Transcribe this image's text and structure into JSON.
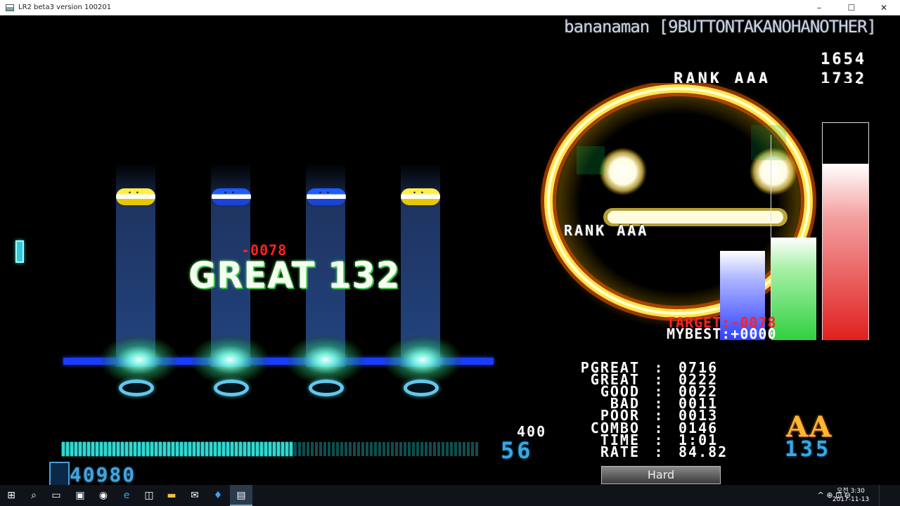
{
  "window": {
    "title": "LR2 beta3 version 100201",
    "minimize": "–",
    "maximize": "☐",
    "close": "✕"
  },
  "game": {
    "song_title": "bananaman [9BUTTONTAKANOHANOTHER]",
    "top_score_1": "1654",
    "top_rank": "RANK AAA",
    "top_score_2": "1732",
    "fast_slow": "-0078",
    "judge": "GREAT 132",
    "rank_mid": "RANK AAA",
    "target": "TARGET:-0078",
    "mybest": "MYBEST:+0000",
    "num_400": "400",
    "bpm_left": "56",
    "bpm_right": "135",
    "ex_score_lead": "0",
    "ex_score": "40980",
    "grade": "AA",
    "gauge_type": "Hard",
    "gauge_fill": 0.56,
    "stats": [
      {
        "label": "PGREAT",
        "value": "0716"
      },
      {
        "label": "GREAT",
        "value": "0222"
      },
      {
        "label": "GOOD",
        "value": "0022"
      },
      {
        "label": "BAD",
        "value": "0011"
      },
      {
        "label": "POOR",
        "value": "0013"
      },
      {
        "label": "COMBO",
        "value": "0146"
      },
      {
        "label": "TIME",
        "value": "1:01"
      },
      {
        "label": "RATE",
        "value": "84.82"
      }
    ],
    "stat_separator": ":",
    "graph": {
      "target_fill": 0.81,
      "current_fill": 0.47,
      "mybest_fill": 0.41,
      "colors": {
        "blue": "#3040ff",
        "green": "#30d040",
        "red": "#e02020"
      }
    },
    "notes": [
      {
        "color": "yellow"
      },
      {
        "color": "blue"
      },
      {
        "color": "blue"
      },
      {
        "color": "yellow"
      }
    ]
  },
  "taskbar": {
    "icons": [
      "windows-start-icon",
      "search-icon",
      "task-view-icon",
      "store-icon",
      "chrome-icon",
      "edge-icon",
      "app-icon",
      "folder-icon",
      "mail-icon",
      "twitter-icon",
      "lr2-icon"
    ],
    "tray": "^ ⊕ ⊡ ⊖",
    "clock_time": "오전 3:30",
    "clock_date": "2017-11-13"
  }
}
